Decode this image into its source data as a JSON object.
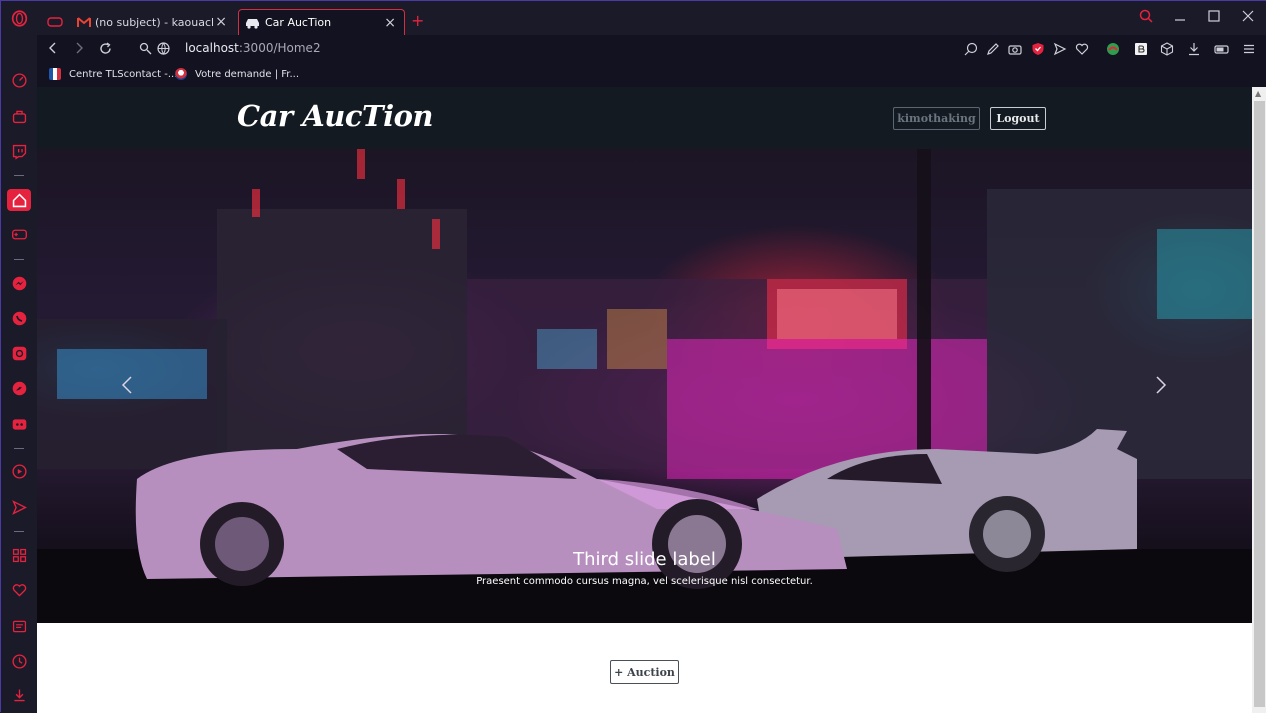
{
  "browser": {
    "tabs": [
      {
        "label": "(no subject) - kaouachimel"
      },
      {
        "label": "Car AucTion"
      }
    ],
    "new_tab_label": "+",
    "url_host": "localhost",
    "url_path": ":3000/Home2",
    "bookmarks": [
      {
        "label": "Centre TLScontact -..."
      },
      {
        "label": "Votre demande | Fr..."
      }
    ],
    "accent_color": "#e6233e",
    "sidebar_icons": [
      "speed-dial-icon",
      "bag-icon",
      "twitch-icon",
      "home-icon",
      "gamepad-icon",
      "messenger-icon",
      "whatsapp-icon",
      "instagram-icon",
      "twitter-icon",
      "discord-icon",
      "player-icon",
      "send-icon",
      "apps-icon",
      "heart-icon",
      "news-icon",
      "history-icon",
      "download-icon"
    ]
  },
  "site": {
    "brand": "Car AucTion",
    "user_button": "kimothaking",
    "logout_button": "Logout",
    "carousel": {
      "prev": "‹",
      "next": "›",
      "caption_title": "Third slide label",
      "caption_text": "Praesent commodo cursus magna, vel scelerisque nisl consectetur."
    },
    "auction_button": "+ Auction"
  }
}
